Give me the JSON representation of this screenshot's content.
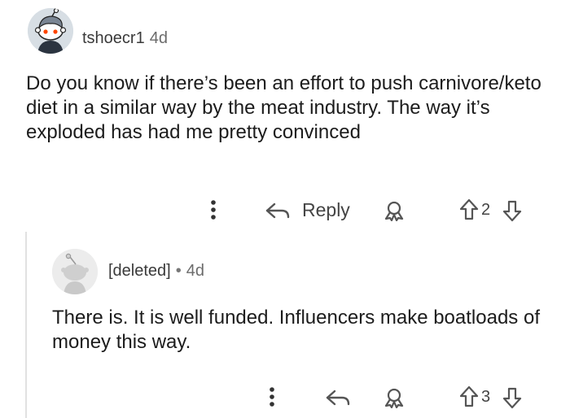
{
  "comment1": {
    "username": "tshoecr1",
    "age": "4d",
    "body": "Do you know if there’s been an effort to push carnivore/keto diet in a similar way by the meat industry. The way it’s exploded has had me pretty convinced",
    "reply_label": "Reply",
    "vote_count": "2",
    "icons": {
      "more": "more-vertical-icon",
      "reply": "reply-arrow-icon",
      "award": "award-icon",
      "upvote": "upvote-arrow-icon",
      "downvote": "downvote-arrow-icon"
    }
  },
  "comment2": {
    "username": "[deleted]",
    "separator": "•",
    "age": "4d",
    "body": "There is. It is well funded. Influencers make boatloads of money this way.",
    "vote_count": "3",
    "icons": {
      "more": "more-vertical-icon",
      "reply": "reply-arrow-icon",
      "award": "award-icon",
      "upvote": "upvote-arrow-icon",
      "downvote": "downvote-arrow-icon"
    }
  }
}
